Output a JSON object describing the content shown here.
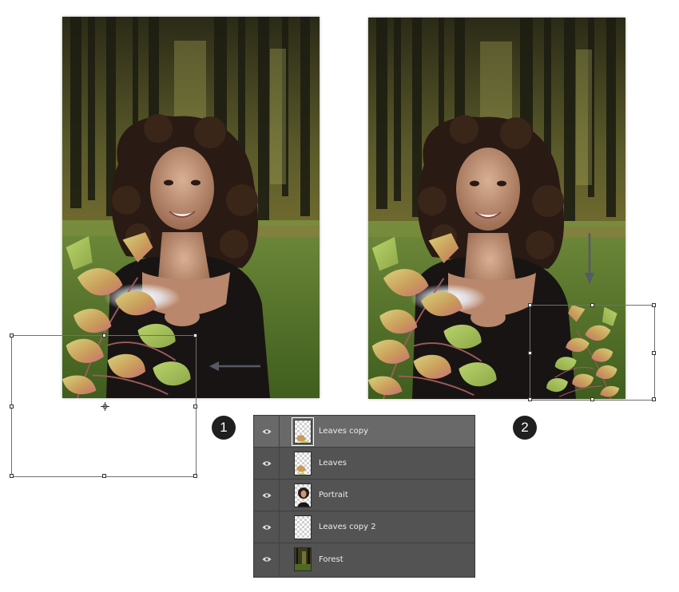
{
  "steps": [
    {
      "number": "1"
    },
    {
      "number": "2"
    }
  ],
  "layers_panel": {
    "layers": [
      {
        "name": "Leaves copy",
        "visible": true,
        "selected": true,
        "thumb": "transparent-leaves-icon"
      },
      {
        "name": "Leaves",
        "visible": true,
        "selected": false,
        "thumb": "transparent-leaves-icon"
      },
      {
        "name": "Portrait",
        "visible": true,
        "selected": false,
        "thumb": "portrait-icon"
      },
      {
        "name": "Leaves copy 2",
        "visible": true,
        "selected": false,
        "thumb": "transparent-icon"
      },
      {
        "name": "Forest",
        "visible": true,
        "selected": false,
        "thumb": "forest-icon"
      }
    ]
  },
  "colors": {
    "panel_bg": "#535353",
    "panel_selected": "#696969",
    "badge": "#1f1f1f",
    "arrow": "#555a66"
  }
}
